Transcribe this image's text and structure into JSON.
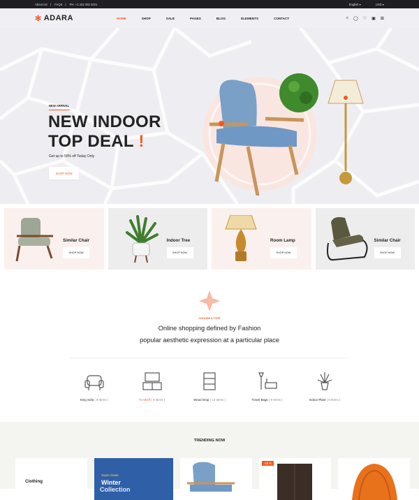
{
  "topbar": {
    "about": "About US",
    "faqs": "FAQS",
    "phone": "PH: +1 222 362 2021",
    "language": "English",
    "currency": "USD"
  },
  "header": {
    "brand": "ADARA",
    "nav": [
      "HOME",
      "SHOP",
      "SALE",
      "PAGES",
      "BLOG",
      "ELEMENTS",
      "CONTACT"
    ]
  },
  "hero": {
    "tag": "NEW ARRIVAL",
    "title_line1": "NEW INDOOR",
    "title_line2": "TOP DEAL",
    "title_mark": "!",
    "subtitle": "Get up to 50% off Today Only",
    "cta": "SHOP NOW"
  },
  "categories": [
    {
      "name": "Similar Chair",
      "cta": "SHOP NOW"
    },
    {
      "name": "Indoor Tree",
      "cta": "SHOP NOW"
    },
    {
      "name": "Room Lamp",
      "cta": "SHOP NOW"
    },
    {
      "name": "Similar Chair",
      "cta": "SHOP NOW"
    }
  ],
  "intro": {
    "small": "CHOOSE A TYPE",
    "line1": "Online shopping defined by Fashion",
    "line2": "popular aesthetic expression at a particular place"
  },
  "types": [
    {
      "label": "King Sofa",
      "count": "( 9 Items )"
    },
    {
      "label": "Tv Shelf",
      "count": "( 9 Items )"
    },
    {
      "label": "Wood Drop",
      "count": "( 12 Items )"
    },
    {
      "label": "Travel Bags",
      "count": "( 9 Items )"
    },
    {
      "label": "Indoor Plant",
      "count": "( 9 Items )"
    }
  ],
  "trending": {
    "title": "TRENDING NOW",
    "card1": "Clothing",
    "promo_a": "Super Deals",
    "promo_b": "Winter",
    "promo_c": "Collection",
    "badge": "-25 %"
  },
  "colors": {
    "accent": "#f15a24",
    "topbar": "#1f1f23",
    "hero_bg": "#eeeef2"
  }
}
